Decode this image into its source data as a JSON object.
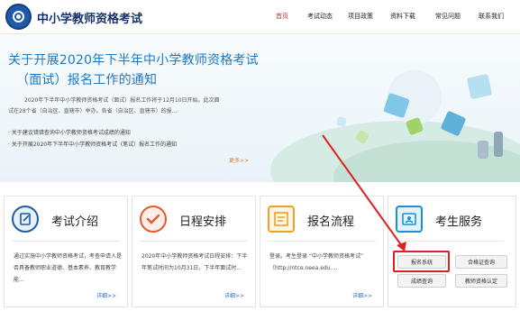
{
  "header": {
    "site_title": "中小学教师资格考试",
    "nav": [
      {
        "label": "首页",
        "active": true
      },
      {
        "label": "考试动态",
        "active": false
      },
      {
        "label": "项目政策",
        "active": false
      },
      {
        "label": "资料下载",
        "active": false
      },
      {
        "label": "常见问题",
        "active": false
      },
      {
        "label": "联系我们",
        "active": false
      }
    ]
  },
  "banner": {
    "title_line1": "关于开展2020年下半年中小学教师资格考试",
    "title_line2": "（面试）报名工作的通知",
    "body_line1": "2020年下半年中小学教师资格考试（面试）报名工作将于12月10日开始。此次面",
    "body_line2": "试在28个省（自治区、直辖市）举办。各省（自治区、直辖市）的报...",
    "links": [
      "关于建议错错查询中小学教师资格考试成绩的通知",
      "关于开展2020年下半年中小学教师资格考试（笔试）报名工作的通知"
    ],
    "more": "更多>>"
  },
  "cards": [
    {
      "title": "考试介绍",
      "desc": "通过实施中小学教师资格考试，考查申请人是否具备教师职业道德、基本素养、教育教学能...",
      "more": "详细>>",
      "icon": "document-edit-icon",
      "icon_color": "#1f5aa8"
    },
    {
      "title": "日程安排",
      "desc": "2020年中小学教师资格考试日程安排：下半年笔试时间为10月31日，下半年面试时...",
      "more": "详细>>",
      "icon": "checkmark-icon",
      "icon_color": "#e2572e"
    },
    {
      "title": "报名流程",
      "desc": "登录。考生登录 “中小学教师资格考试” （http://ntce.neea.edu....",
      "more": "详细>>",
      "icon": "form-icon",
      "icon_color": "#f0a024"
    },
    {
      "title": "考生服务",
      "icon": "id-card-icon",
      "icon_color": "#1e8fd6",
      "buttons": [
        "报名系统",
        "合格证查询",
        "成绩查询",
        "教师资格认定"
      ]
    }
  ],
  "colors": {
    "brand_blue": "#1c79c4",
    "active_nav": "#c0392b",
    "annotation_red": "#e02020"
  }
}
